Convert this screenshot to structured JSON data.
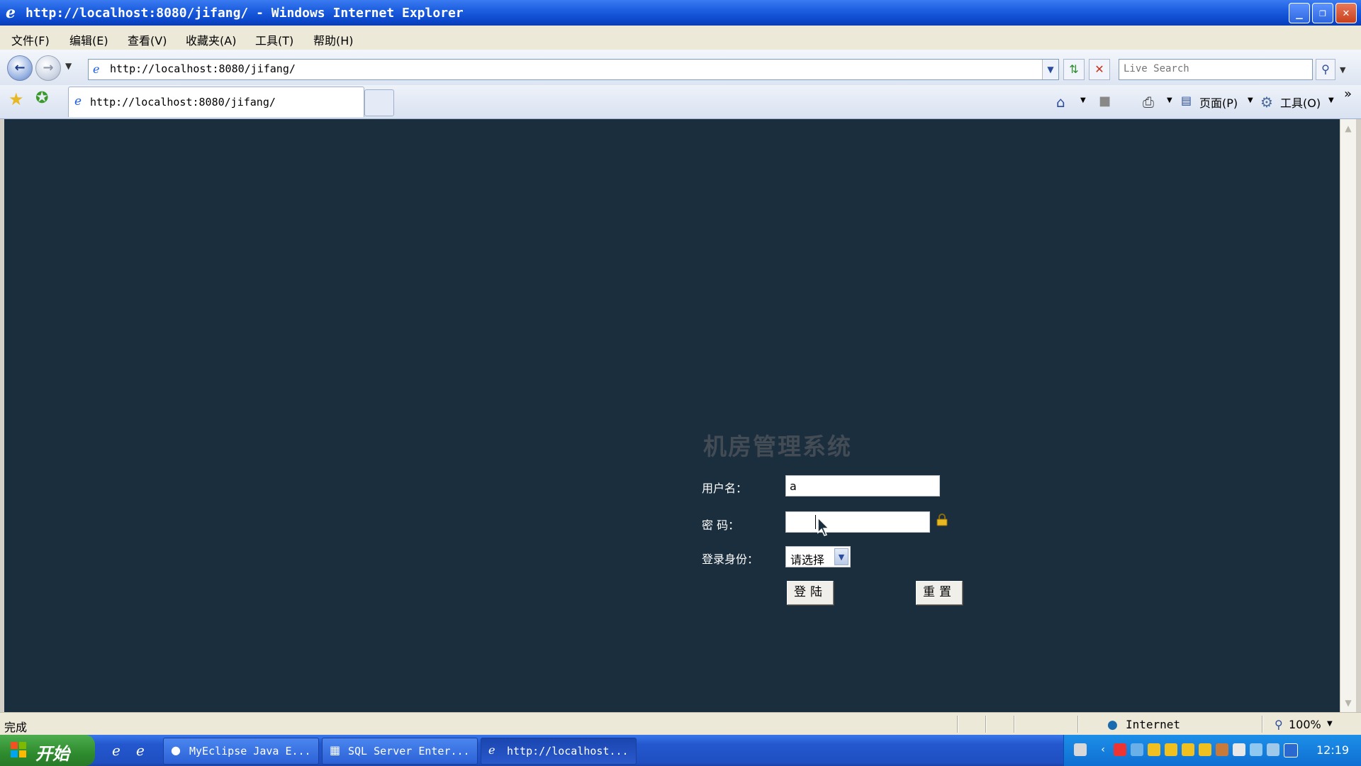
{
  "window": {
    "title": "http://localhost:8080/jifang/ - Windows Internet Explorer",
    "controls": [
      "_",
      "❐",
      "✕"
    ]
  },
  "menubar": {
    "items": [
      "文件(F)",
      "编辑(E)",
      "查看(V)",
      "收藏夹(A)",
      "工具(T)",
      "帮助(H)"
    ]
  },
  "address": {
    "url": "http://localhost:8080/jifang/",
    "search_placeholder": "Live Search"
  },
  "tab": {
    "title": "http://localhost:8080/jifang/"
  },
  "commandbar": {
    "page_label": "页面(P)",
    "tools_label": "工具(O)"
  },
  "login": {
    "heading": "机房管理系统",
    "username_label": "用户名：",
    "username_value": "a",
    "password_label": "密  码：",
    "password_value": "",
    "role_label": "登录身份：",
    "role_selected": "请选择",
    "login_button": "登陆",
    "reset_button": "重置"
  },
  "statusbar": {
    "status": "完成",
    "zone": "Internet",
    "zoom": "100%"
  },
  "taskbar": {
    "start_label": "开始",
    "tasks": [
      {
        "label": "MyEclipse Java E..."
      },
      {
        "label": "SQL Server Enter..."
      },
      {
        "label": "http://localhost..."
      }
    ],
    "clock": "12:19"
  },
  "colors": {
    "content_bg": "#1b2e3e",
    "heading": "#434c55",
    "titlebar": "#1d5ee0"
  }
}
